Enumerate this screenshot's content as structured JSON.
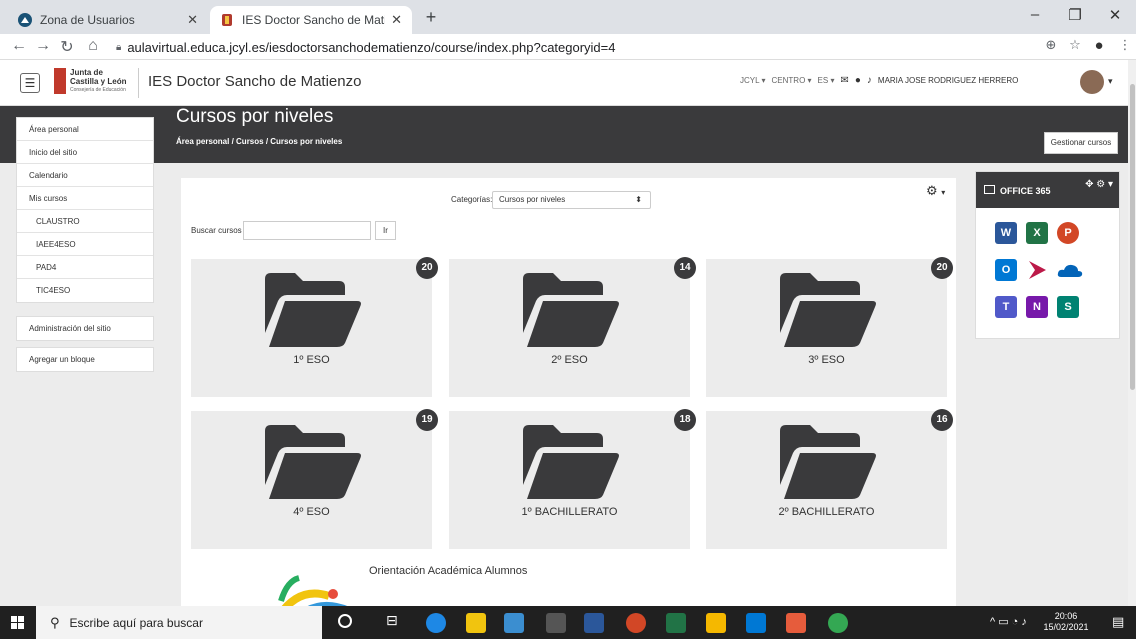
{
  "browser": {
    "tabs": [
      {
        "title": "Zona de Usuarios",
        "active": false
      },
      {
        "title": "IES Doctor Sancho de Matienzo",
        "active": true
      }
    ],
    "url": "aulavirtual.educa.jcyl.es/iesdoctorsanchodematienzo/course/index.php?categoryid=4"
  },
  "navbar": {
    "site_name": "IES Doctor Sancho de Matienzo",
    "logo_text_1": "Junta de",
    "logo_text_2": "Castilla y León",
    "logo_text_3": "Consejería de Educación",
    "menu_jcyl": "JCYL",
    "menu_centro": "CENTRO",
    "menu_lang": "ES",
    "user_name": "MARIA JOSE RODRIGUEZ HERRERO"
  },
  "header": {
    "title": "Cursos por niveles",
    "breadcrumb": [
      "Área personal",
      "Cursos",
      "Cursos por niveles"
    ],
    "manage_button": "Gestionar cursos"
  },
  "left_menu": {
    "group1": [
      "Área personal",
      "Inicio del sitio",
      "Calendario"
    ],
    "my_courses_label": "Mis cursos",
    "my_courses": [
      "CLAUSTRO",
      "IAEE4ESO",
      "PAD4",
      "TIC4ESO"
    ],
    "admin": "Administración del sitio",
    "add_block": "Agregar un bloque"
  },
  "main": {
    "categories_label": "Categorías:",
    "category_selected": "Cursos por niveles",
    "search_label": "Buscar cursos",
    "search_value": "",
    "go_button": "Ir",
    "cards": [
      {
        "name": "1º ESO",
        "count": "20"
      },
      {
        "name": "2º ESO",
        "count": "14"
      },
      {
        "name": "3º ESO",
        "count": "20"
      },
      {
        "name": "4º ESO",
        "count": "19"
      },
      {
        "name": "1º BACHILLERATO",
        "count": "18"
      },
      {
        "name": "2º BACHILLERATO",
        "count": "16"
      }
    ],
    "orientation_title": "Orientación Académica Alumnos"
  },
  "office": {
    "title": "OFFICE 365",
    "apps": [
      {
        "icon": "word-icon",
        "letter": "W",
        "color": "#2b579a"
      },
      {
        "icon": "excel-icon",
        "letter": "X",
        "color": "#217346"
      },
      {
        "icon": "powerpoint-icon",
        "letter": "P",
        "color": "#d24726"
      },
      {
        "icon": "outlook-icon",
        "letter": "O",
        "color": "#0078d4"
      },
      {
        "icon": "stream-icon",
        "letter": "",
        "color": "#bc1948"
      },
      {
        "icon": "onedrive-icon",
        "letter": "",
        "color": "#0364b8"
      },
      {
        "icon": "teams-icon",
        "letter": "T",
        "color": "#5059c9"
      },
      {
        "icon": "onenote-icon",
        "letter": "N",
        "color": "#7719aa"
      },
      {
        "icon": "sway-icon",
        "letter": "S",
        "color": "#008272"
      }
    ]
  },
  "taskbar": {
    "search_placeholder": "Escribe aquí para buscar",
    "time": "20:06",
    "date": "15/02/2021"
  }
}
